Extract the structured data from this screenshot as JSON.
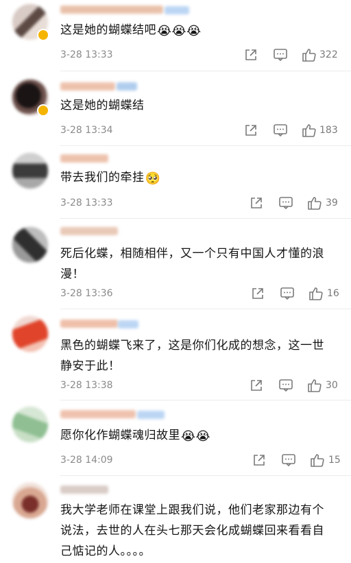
{
  "comments": [
    {
      "text": "这是她的蝴蝶结吧",
      "emojis": "😭😭😭",
      "time": "3-28 13:33",
      "likes": "322"
    },
    {
      "text": "这是她的蝴蝶结",
      "emojis": "",
      "time": "3-28 13:34",
      "likes": "183"
    },
    {
      "text": "带去我们的牵挂",
      "emojis": "🥺",
      "time": "3-28 13:33",
      "likes": "39"
    },
    {
      "text": "死后化蝶，相随相伴，又一个只有中国人才懂的浪漫！",
      "emojis": "",
      "time": "3-28 13:36",
      "likes": "16"
    },
    {
      "text": "黑色的蝴蝶飞来了，这是你们化成的想念，这一世静安于此！",
      "emojis": "",
      "time": "3-28 13:38",
      "likes": "30"
    },
    {
      "text": "愿你化作蝴蝶魂归故里",
      "emojis": "😭😭",
      "time": "3-28 14:09",
      "likes": "15"
    },
    {
      "text": "我大学老师在课堂上跟我们说，他们老家那边有个说法，去世的人在头七那天会化成蝴蝶回来看看自己惦记的人。。。。",
      "emojis": "",
      "time": "",
      "likes": ""
    }
  ],
  "icons": {
    "share": "share-icon",
    "comment": "comment-icon",
    "like": "thumbs-up-icon"
  },
  "colors": {
    "text": "#151515",
    "meta": "#8a8a8a",
    "divider": "#ececec",
    "badge": "#f5b400"
  }
}
